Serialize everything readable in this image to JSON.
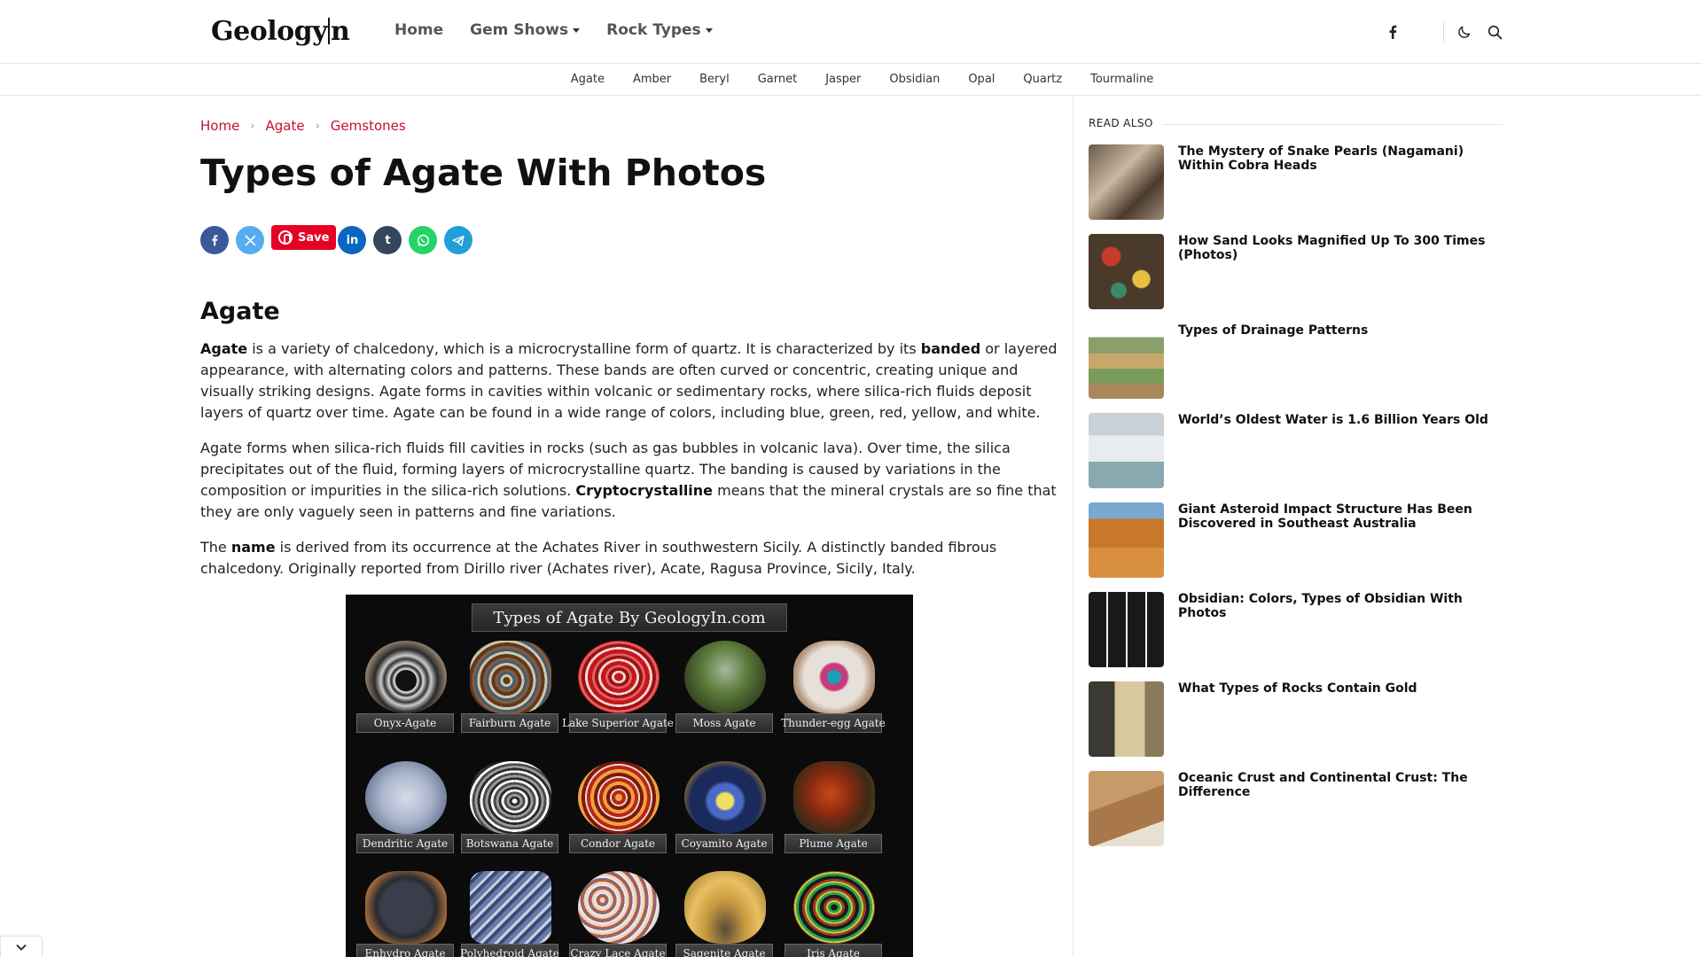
{
  "header": {
    "logo": "GeologyIn",
    "nav": [
      {
        "label": "Home",
        "dropdown": false
      },
      {
        "label": "Gem Shows",
        "dropdown": true
      },
      {
        "label": "Rock Types",
        "dropdown": true
      }
    ],
    "icons": [
      "facebook-icon",
      "moon-icon",
      "search-icon"
    ]
  },
  "categories": [
    "Agate",
    "Amber",
    "Beryl",
    "Garnet",
    "Jasper",
    "Obsidian",
    "Opal",
    "Quartz",
    "Tourmaline"
  ],
  "breadcrumb": [
    "Home",
    "Agate",
    "Gemstones"
  ],
  "article": {
    "title": "Types of Agate With Photos",
    "share_save_label": "Save",
    "section_heading": "Agate",
    "p1": {
      "b1": "Agate",
      "t1": " is a variety of chalcedony, which is a microcrystalline form of quartz. It is characterized by its ",
      "b2": "banded",
      "t2": " or layered appearance, with alternating colors and patterns. These bands are often curved or concentric, creating unique and visually striking designs. Agate forms in cavities within volcanic or sedimentary rocks, where silica-rich fluids deposit layers of quartz over time. Agate can be found in a wide range of colors, including blue, green, red, yellow, and white."
    },
    "p2": {
      "t1": "Agate forms when silica-rich fluids fill cavities in rocks (such as gas bubbles in volcanic lava). Over time, the silica precipitates out of the fluid, forming layers of microcrystalline quartz. The banding is caused by variations in the composition or impurities in the silica-rich solutions. ",
      "b1": "Cryptocrystalline",
      "t2": " means that the mineral crystals are so fine that they are only vaguely seen in patterns and fine variations."
    },
    "p3": {
      "t1": "The ",
      "b1": "name",
      "t2": " is derived from its occurrence at the Achates River in southwestern Sicily. A distinctly banded fibrous chalcedony. Originally reported from Dirillo river (Achates river), Acate, Ragusa Province, Sicily, Italy."
    },
    "image": {
      "banner": "Types of Agate By GeologyIn.com",
      "labels": [
        "Onyx-Agate",
        "Fairburn Agate",
        "Lake Superior Agate",
        "Moss Agate",
        "Thunder-egg Agate",
        "Dendritic Agate",
        "Botswana Agate",
        "Condor Agate",
        "Coyamito Agate",
        "Plume Agate",
        "Enhydro Agate",
        "Polyhedroid Agate",
        "Crazy Lace Agate",
        "Sagenite Agate",
        "Iris Agate"
      ]
    }
  },
  "sidebar": {
    "heading": "READ ALSO",
    "items": [
      "The Mystery of Snake Pearls (Nagamani) Within Cobra Heads",
      "How Sand Looks Magnified Up To 300 Times (Photos)",
      "Types of Drainage Patterns",
      "World’s Oldest Water is 1.6 Billion Years Old",
      "Giant Asteroid Impact Structure Has Been Discovered in Southeast Australia",
      "Obsidian: Colors, Types of Obsidian With Photos",
      "What Types of Rocks Contain Gold",
      "Oceanic Crust and Continental Crust: The Difference"
    ]
  },
  "colors": {
    "accent": "#c8102e",
    "facebook": "#3b5998",
    "twitter": "#55acee",
    "pinterest": "#e60023",
    "linkedin": "#0a66c2",
    "tumblr": "#35465c",
    "whatsapp": "#25d366",
    "telegram": "#229ed9"
  }
}
